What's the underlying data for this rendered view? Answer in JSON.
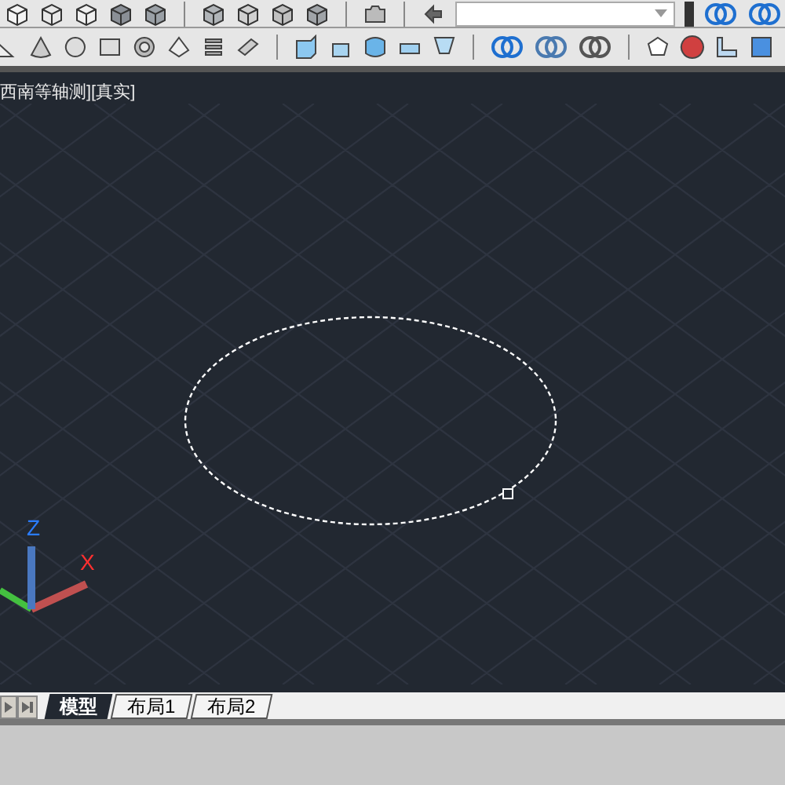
{
  "viewport": {
    "label": "西南等轴测][真实]",
    "axis_z": "Z",
    "axis_x": "X"
  },
  "layout_tabs": [
    {
      "label": "模型",
      "selected": true
    },
    {
      "label": "布局1",
      "selected": false
    },
    {
      "label": "布局2",
      "selected": false
    }
  ]
}
